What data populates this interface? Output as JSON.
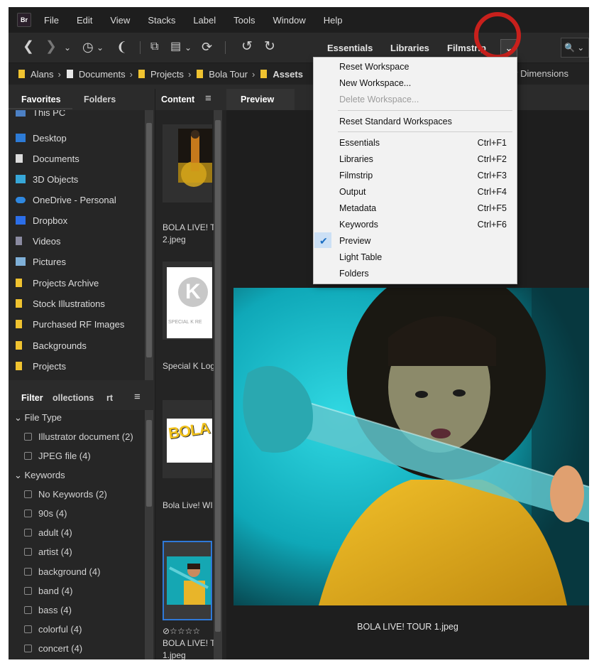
{
  "menu": {
    "logo": "Br",
    "items": [
      "File",
      "Edit",
      "View",
      "Stacks",
      "Label",
      "Tools",
      "Window",
      "Help"
    ]
  },
  "toolbar": {
    "workspaces": [
      "Essentials",
      "Libraries",
      "Filmstrip"
    ],
    "dropdown_glyph": "⌄",
    "search_glyph": "🔍 ⌄"
  },
  "path": {
    "crumbs": [
      "Alans",
      "Documents",
      "Projects",
      "Bola Tour",
      "Assets"
    ],
    "sort_label": "y Dimensions"
  },
  "left": {
    "tabs": [
      "Favorites",
      "Folders"
    ],
    "favorites": [
      {
        "label": "This PC",
        "icon": "pc-icon"
      },
      {
        "label": "Desktop",
        "icon": "desktop-icon"
      },
      {
        "label": "Documents",
        "icon": "documents-icon"
      },
      {
        "label": "3D Objects",
        "icon": "3d-objects-icon"
      },
      {
        "label": "OneDrive - Personal",
        "icon": "onedrive-icon"
      },
      {
        "label": "Dropbox",
        "icon": "dropbox-icon"
      },
      {
        "label": "Videos",
        "icon": "videos-icon"
      },
      {
        "label": "Pictures",
        "icon": "pictures-icon"
      },
      {
        "label": "Projects Archive",
        "icon": "folder-icon"
      },
      {
        "label": "Stock Illustrations",
        "icon": "folder-icon"
      },
      {
        "label": "Purchased RF Images",
        "icon": "folder-icon"
      },
      {
        "label": "Backgrounds",
        "icon": "folder-icon"
      },
      {
        "label": "Projects",
        "icon": "folder-icon"
      }
    ],
    "filter_tabs": [
      "Filter",
      "ollections",
      "rt"
    ],
    "filter": {
      "file_type_head": "File Type",
      "file_types": [
        "Illustrator document (2)",
        "JPEG file (4)"
      ],
      "keywords_head": "Keywords",
      "keywords": [
        "No Keywords (2)",
        "90s (4)",
        "adult (4)",
        "artist (4)",
        "background (4)",
        "band (4)",
        "bass (4)",
        "colorful (4)",
        "concert (4)"
      ]
    }
  },
  "content": {
    "tab": "Content",
    "items": [
      {
        "line1": "BOLA LIVE! T",
        "line2": "2.jpeg"
      },
      {
        "line1": "Special K Log",
        "line2": ""
      },
      {
        "line1": "Bola Live! WI",
        "line2": ""
      },
      {
        "line1": "BOLA LIVE! T",
        "line2": "1.jpeg",
        "rating": "⊘☆☆☆☆"
      }
    ],
    "thumb_text_k": "SPECIAL K RE",
    "thumb_text_bola": "BOLA LIV"
  },
  "preview": {
    "tab": "Preview",
    "caption": "BOLA LIVE! TOUR 1.jpeg"
  },
  "workspace_menu": {
    "group1": [
      {
        "label": "Reset Workspace",
        "enabled": true
      },
      {
        "label": "New Workspace...",
        "enabled": true
      },
      {
        "label": "Delete Workspace...",
        "enabled": false
      }
    ],
    "group2": [
      {
        "label": "Reset Standard Workspaces",
        "enabled": true
      }
    ],
    "group3": [
      {
        "label": "Essentials",
        "shortcut": "Ctrl+F1"
      },
      {
        "label": "Libraries",
        "shortcut": "Ctrl+F2"
      },
      {
        "label": "Filmstrip",
        "shortcut": "Ctrl+F3"
      },
      {
        "label": "Output",
        "shortcut": "Ctrl+F4"
      },
      {
        "label": "Metadata",
        "shortcut": "Ctrl+F5"
      },
      {
        "label": "Keywords",
        "shortcut": "Ctrl+F6"
      },
      {
        "label": "Preview",
        "shortcut": "",
        "checked": true
      },
      {
        "label": "Light Table",
        "shortcut": ""
      },
      {
        "label": "Folders",
        "shortcut": ""
      }
    ],
    "check_glyph": "✔"
  },
  "colors": {
    "accent_highlight": "#c8201c",
    "folder": "#f0c330",
    "check": "#1b6ec2"
  }
}
